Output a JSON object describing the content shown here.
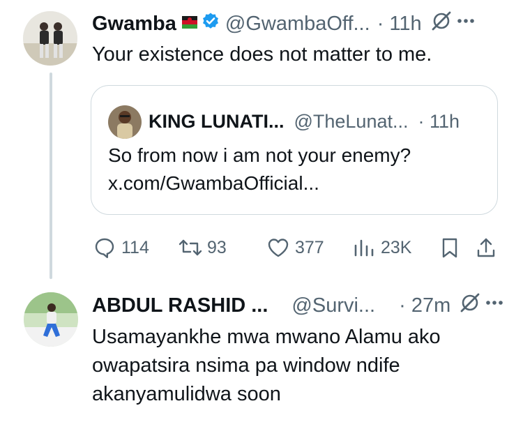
{
  "tweet": {
    "display_name": "Gwamba",
    "handle": "@GwambaOff...",
    "time": "· 11h",
    "text": "Your existence does not matter to me.",
    "quote": {
      "display_name": "KING LUNATI...",
      "handle": "@TheLunat...",
      "time": "· 11h",
      "text_line1": "So from now i am not your enemy?",
      "text_line2": "x.com/GwambaOfficial..."
    },
    "actions": {
      "replies": "114",
      "reposts": "93",
      "likes": "377",
      "views": "23K"
    }
  },
  "reply": {
    "display_name": "ABDUL RASHID ...",
    "handle": "@Survi...",
    "time": "· 27m",
    "text_line1": "Usamayankhe mwa mwano Alamu ako",
    "text_line2": "owapatsira nsima pa window ndife",
    "text_line3": "akanyamulidwa soon"
  },
  "colors": {
    "accent": "#1d9bf0",
    "text": "#0f1419",
    "muted": "#536471",
    "border": "#cfd9de"
  }
}
